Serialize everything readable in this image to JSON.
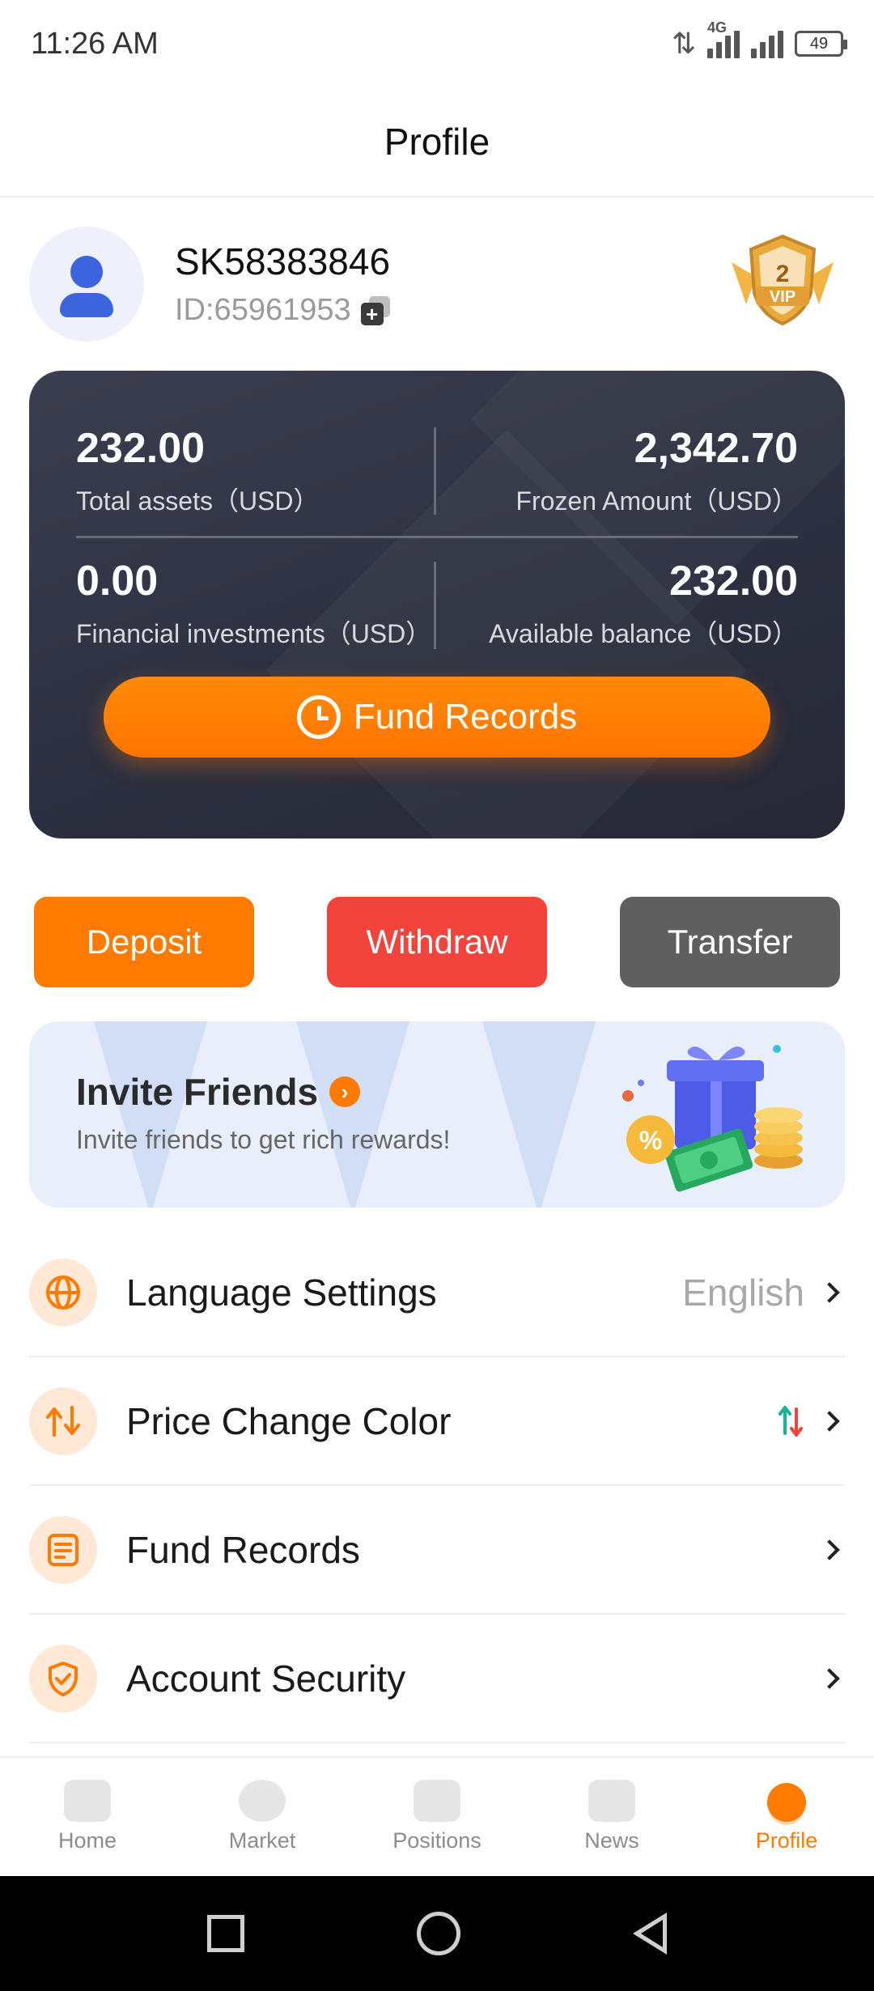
{
  "status_bar": {
    "time": "11:26 AM",
    "network": "4G",
    "battery": "49"
  },
  "header": {
    "title": "Profile"
  },
  "user": {
    "username": "SK58383846",
    "id_text": "ID:65961953",
    "vip_level": "2",
    "vip_text": "VIP"
  },
  "assets": {
    "total": {
      "value": "232.00",
      "label": "Total assets（USD）"
    },
    "frozen": {
      "value": "2,342.70",
      "label": "Frozen Amount（USD）"
    },
    "financial": {
      "value": "0.00",
      "label": "Financial investments（USD）"
    },
    "available": {
      "value": "232.00",
      "label": "Available balance（USD）"
    },
    "fund_records_button": "Fund Records"
  },
  "actions": {
    "deposit": "Deposit",
    "withdraw": "Withdraw",
    "transfer": "Transfer"
  },
  "invite": {
    "title": "Invite Friends",
    "subtitle": "Invite friends to get rich rewards!"
  },
  "menu": [
    {
      "label": "Language Settings",
      "value": "English",
      "icon": "globe-icon"
    },
    {
      "label": "Price Change Color",
      "value": "",
      "icon": "price-change-icon"
    },
    {
      "label": "Fund Records",
      "value": "",
      "icon": "document-icon"
    },
    {
      "label": "Account Security",
      "value": "",
      "icon": "shield-check-icon"
    }
  ],
  "tabbar": [
    {
      "label": "Home",
      "active": false
    },
    {
      "label": "Market",
      "active": false
    },
    {
      "label": "Positions",
      "active": false
    },
    {
      "label": "News",
      "active": false
    },
    {
      "label": "Profile",
      "active": true
    }
  ],
  "colors": {
    "accent": "#ff7a00",
    "withdraw": "#f2433c",
    "transfer": "#5f5f5f",
    "card": "#2d3040",
    "up_arrow": "#16b39a",
    "down_arrow": "#f2433c"
  }
}
